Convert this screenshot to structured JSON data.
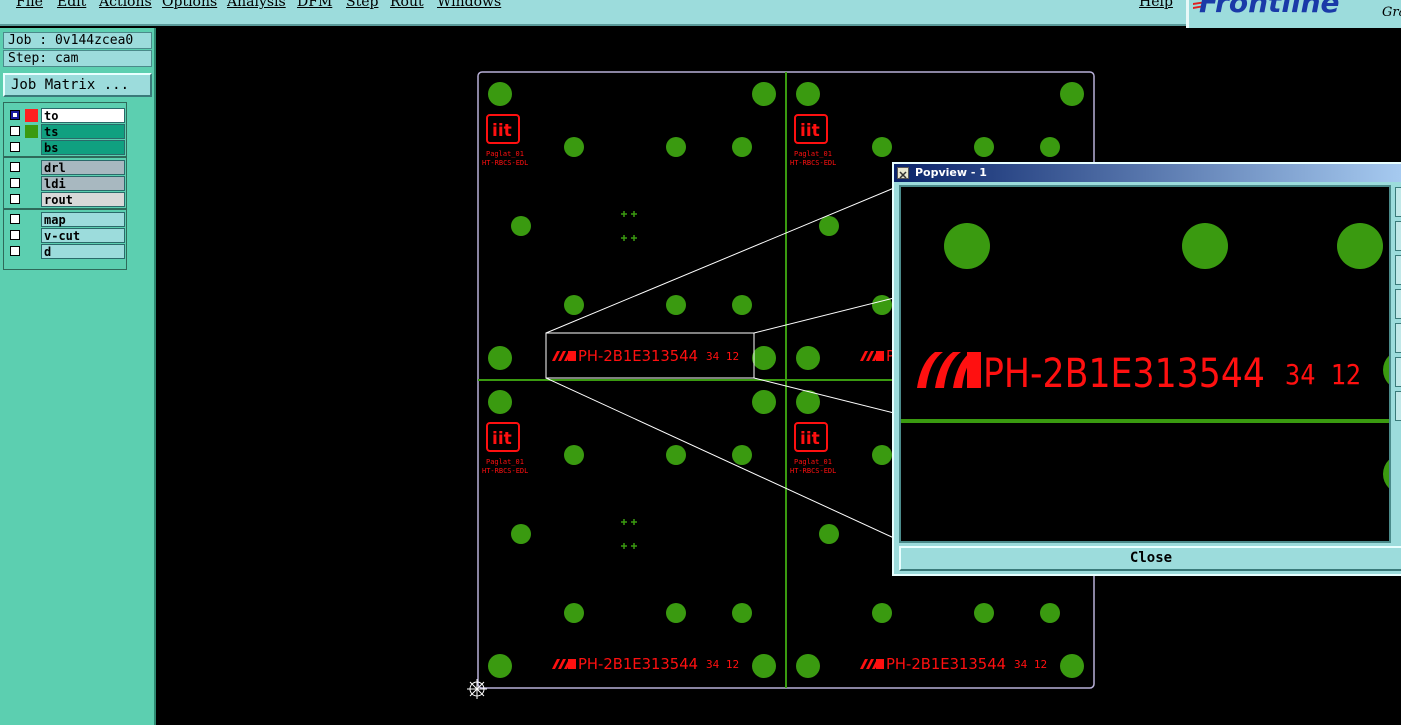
{
  "menu": {
    "items": [
      "File",
      "Edit",
      "Actions",
      "Options",
      "Analysis",
      "DFM",
      "Step",
      "Rout",
      "Windows"
    ],
    "help": "Help"
  },
  "logo": {
    "text": "Frontline",
    "sub": "Gra"
  },
  "panel": {
    "job": "Job : 0v144zcea0",
    "step": "Step: cam",
    "matrix_button": "Job Matrix ..."
  },
  "layers": [
    {
      "name": "to",
      "color": "#ff2020",
      "checked": true,
      "active": true,
      "bg": "#ffffff",
      "group": 0
    },
    {
      "name": "ts",
      "color": "#3a9a10",
      "checked": false,
      "active": false,
      "bg": "#10a080",
      "group": 0
    },
    {
      "name": "bs",
      "color": "",
      "checked": false,
      "active": false,
      "bg": "#10a080",
      "group": 0
    },
    {
      "name": "drl",
      "color": "",
      "checked": false,
      "active": false,
      "bg": "#a8b8c0",
      "group": 1
    },
    {
      "name": "ldi",
      "color": "",
      "checked": false,
      "active": false,
      "bg": "#a8b8c0",
      "group": 1
    },
    {
      "name": "rout",
      "color": "",
      "checked": false,
      "active": false,
      "bg": "#d8d8d8",
      "group": 1
    },
    {
      "name": "map",
      "color": "",
      "checked": false,
      "active": false,
      "bg": "#9cdcdc",
      "group": 2
    },
    {
      "name": "v-cut",
      "color": "",
      "checked": false,
      "active": false,
      "bg": "#9cdcdc",
      "group": 2
    },
    {
      "name": "d",
      "color": "",
      "checked": false,
      "active": false,
      "bg": "#9cdcdc",
      "group": 2
    }
  ],
  "board": {
    "marking": "PH-2B1E313544",
    "datecode": "34 12",
    "part_label_1": "Paglat_01",
    "part_label_2": "HT-RBCS-EDL",
    "logo_text": "iit"
  },
  "popview": {
    "title": "Popview - 1",
    "close_label": "Close"
  },
  "colors": {
    "pad_green": "#3a9a10",
    "mark_red": "#ff1010",
    "outline": "#b8b0d8",
    "panel_bg": "#5ccfb0",
    "menu_bg": "#9cdcdc"
  }
}
